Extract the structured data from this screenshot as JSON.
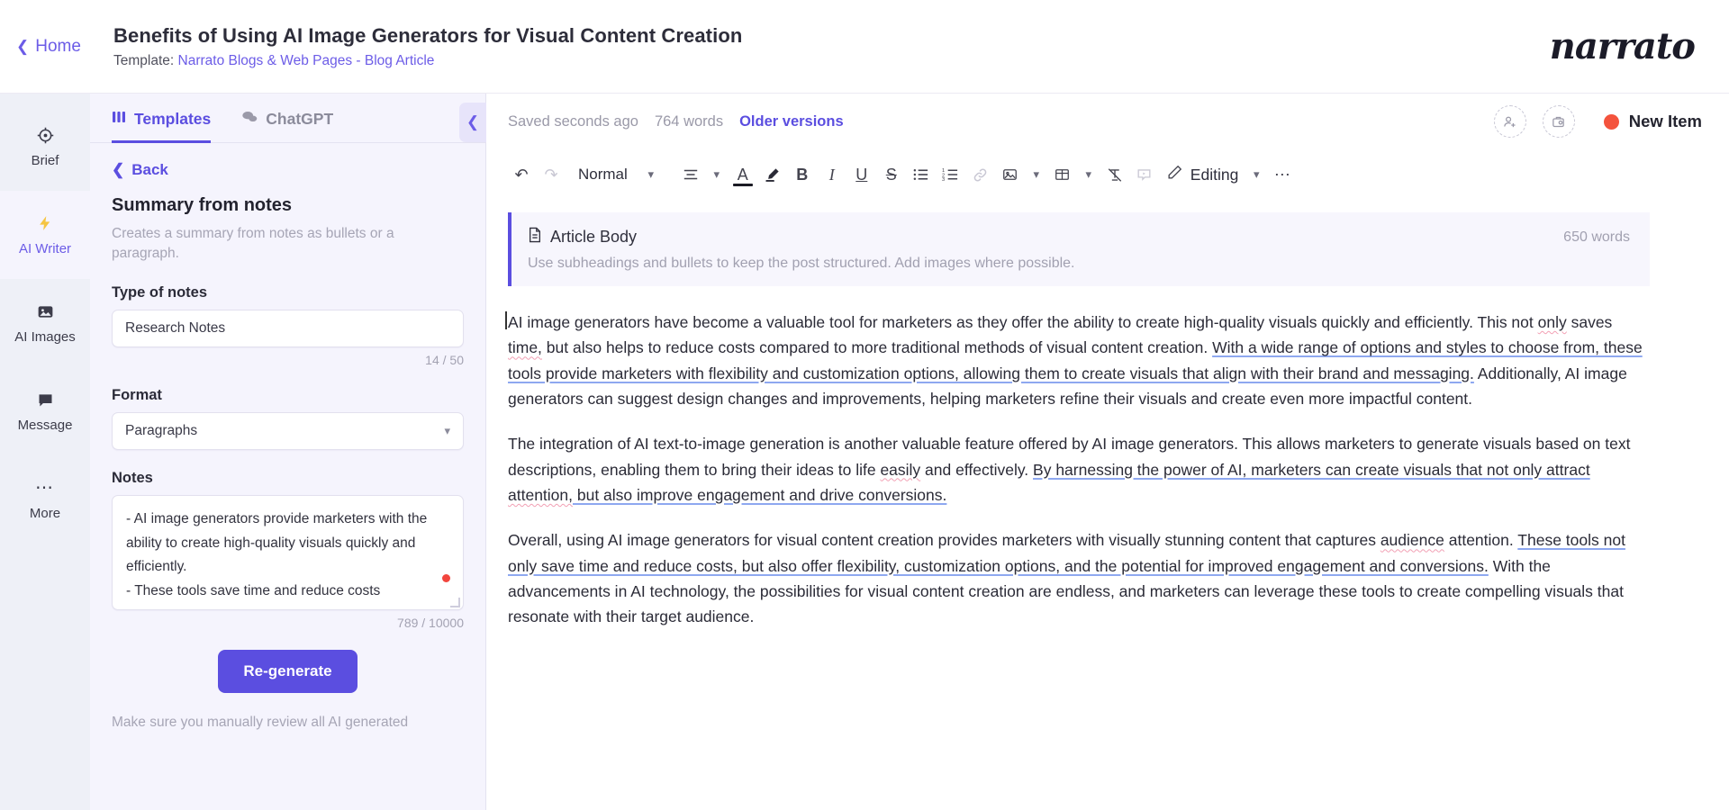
{
  "header": {
    "home_label": "Home",
    "back_icon": "chevron-left-icon",
    "doc_title": "Benefits of Using AI Image Generators for Visual Content Creation",
    "template_prefix": "Template: ",
    "template_link": "Narrato Blogs & Web Pages - Blog Article",
    "brand": "narrato"
  },
  "rail": {
    "items": [
      {
        "label": "Brief",
        "icon": "target-icon",
        "glyph": "☉",
        "active": false
      },
      {
        "label": "AI Writer",
        "icon": "lightning-bolt-icon",
        "glyph": "⚡",
        "active": true
      },
      {
        "label": "AI Images",
        "icon": "image-icon",
        "glyph": "ὛC",
        "active": false
      },
      {
        "label": "Message",
        "icon": "chat-bubble-icon",
        "glyph": "὞9",
        "active": false
      },
      {
        "label": "More",
        "icon": "ellipsis-icon",
        "glyph": "•••",
        "active": false
      }
    ]
  },
  "panel": {
    "tabs": [
      {
        "label": "Templates",
        "icon": "templates-grid-icon",
        "active": true
      },
      {
        "label": "ChatGPT",
        "icon": "chat-bubbles-icon",
        "active": false
      }
    ],
    "back_label": "Back",
    "template_name": "Summary from notes",
    "template_desc": "Creates a summary from notes as bullets or a paragraph.",
    "type_of_notes": {
      "label": "Type of notes",
      "value": "Research Notes",
      "counter": "14 / 50"
    },
    "format": {
      "label": "Format",
      "value": "Paragraphs"
    },
    "notes": {
      "label": "Notes",
      "value": "- AI image generators provide marketers with the ability to create high-quality visuals quickly and efficiently.\n- These tools save time and reduce costs",
      "counter": "789 / 10000"
    },
    "regenerate_label": "Re-generate",
    "disclaimer": "Make sure you manually review all AI generated",
    "collapse_icon": "chevron-left-icon"
  },
  "editor": {
    "status": {
      "saved": "Saved seconds ago",
      "words": "764 words",
      "older_versions": "Older versions"
    },
    "actions": {
      "add_user_icon": "add-user-icon",
      "assign_task_icon": "assign-task-icon",
      "new_item_label": "New Item",
      "new_item_dot_color": "#f4533d"
    },
    "toolbar": {
      "undo": "undo-icon",
      "redo": "redo-icon",
      "style": "Normal",
      "editing_label": "Editing"
    },
    "section": {
      "icon": "document-icon",
      "title": "Article Body",
      "word_count": "650 words",
      "hint": "Use subheadings and bullets to keep the post structured. Add images where possible."
    },
    "paragraphs": [
      {
        "runs": [
          {
            "t": "AI image generators have become a valuable tool for marketers as they offer the ability to create high-quality visuals quickly and efficiently. This not ",
            "s": ""
          },
          {
            "t": "only",
            "s": "sq"
          },
          {
            "t": " saves ",
            "s": ""
          },
          {
            "t": "time,",
            "s": "sq"
          },
          {
            "t": " but also helps to reduce costs compared to more traditional methods of visual content creation. ",
            "s": ""
          },
          {
            "t": "With a wide range of options and styles to choose from, these tools provide marketers with flexibility and customization options, allowing them to create visuals that align with their brand and messaging.",
            "s": "sb"
          },
          {
            "t": " Additionally, AI image generators can suggest design changes and improvements, helping marketers refine their visuals and create even more impactful content.",
            "s": ""
          }
        ]
      },
      {
        "runs": [
          {
            "t": "The integration of AI text-to-image generation is another valuable feature offered by AI image generators. This allows marketers to generate visuals based on text descriptions, enabling them to bring their ideas to life ",
            "s": ""
          },
          {
            "t": "easily",
            "s": "sq"
          },
          {
            "t": " and effectively. ",
            "s": ""
          },
          {
            "t": "By harnessing the power of AI, marketers can create visuals that not only attract ",
            "s": "sb"
          },
          {
            "t": "attention,",
            "s": "sq"
          },
          {
            "t": " but also improve engagement and drive conversions.",
            "s": "sb"
          }
        ]
      },
      {
        "runs": [
          {
            "t": "Overall, using AI image generators for visual content creation provides marketers with visually stunning content that captures ",
            "s": ""
          },
          {
            "t": "audience",
            "s": "sq"
          },
          {
            "t": " attention. ",
            "s": ""
          },
          {
            "t": "These tools not only save time and reduce costs, but also offer flexibility, customization options, and the potential for improved engagement and conversions.",
            "s": "sb"
          },
          {
            "t": " With the advancements in AI technology, the possibilities for visual content creation are endless, and marketers can leverage these tools to create compelling visuals that resonate with their target audience.",
            "s": ""
          }
        ]
      }
    ]
  },
  "colors": {
    "accent": "#5b4ee0",
    "panel_bg": "#f5f4fd",
    "rail_bg": "#eef0f7",
    "status_red": "#f4533d"
  }
}
